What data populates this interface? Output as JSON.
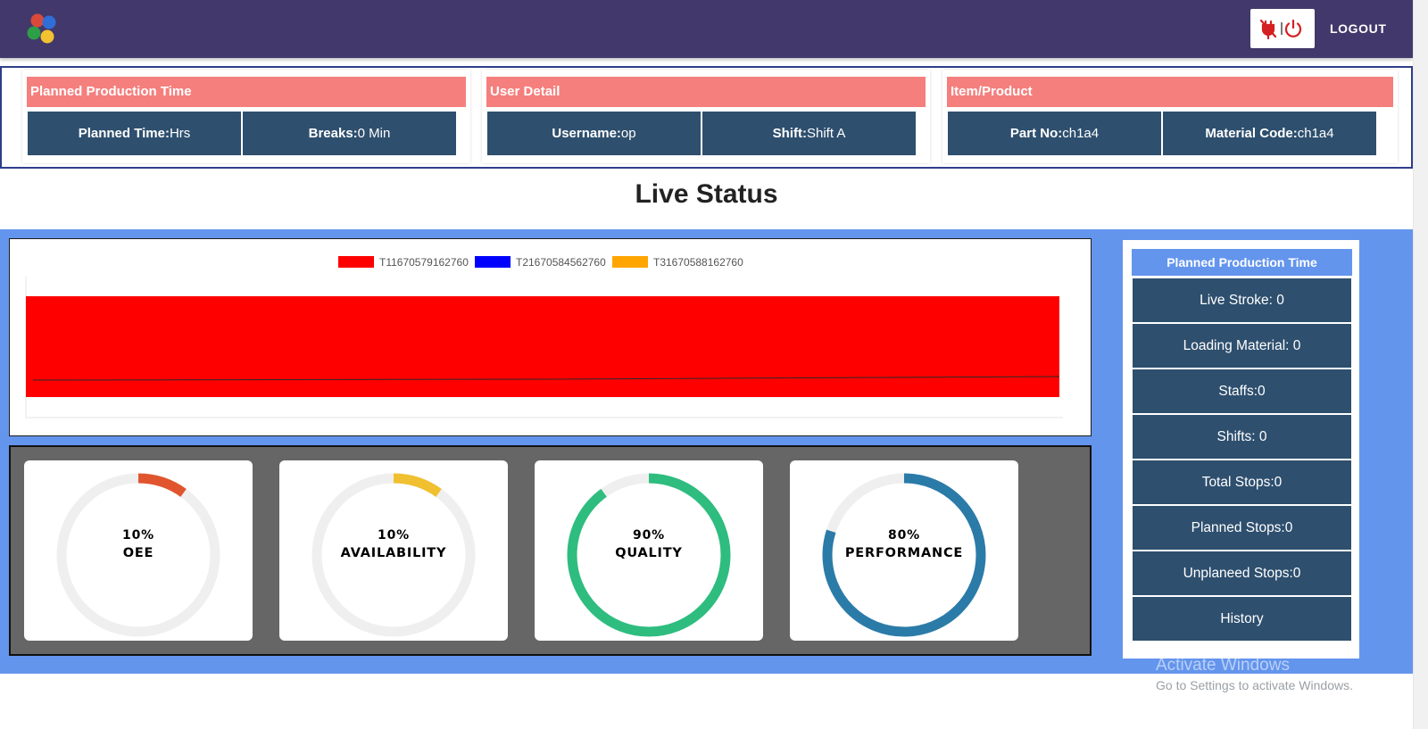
{
  "navbar": {
    "logout_label": "LOGOUT",
    "logo_icon": "colored-dots-logo-icon",
    "connection_icon": "unplugged-power-icon"
  },
  "info": {
    "production": {
      "title": "Planned Production Time",
      "planned_key": "Planned Time:",
      "planned_val": "Hrs",
      "breaks_key": "Breaks:",
      "breaks_val": "0 Min"
    },
    "user": {
      "title": "User Detail",
      "username_key": "Username:",
      "username_val": "op",
      "shift_key": "Shift:",
      "shift_val": "Shift A"
    },
    "item": {
      "title": "Item/Product",
      "part_key": "Part No:",
      "part_val": "ch1a4",
      "material_key": "Material Code:",
      "material_val": "ch1a4"
    }
  },
  "page_title": "Live Status",
  "chart_data": {
    "type": "area",
    "series": [
      {
        "name": "T11670579162760",
        "color": "#ff0000"
      },
      {
        "name": "T21670584562760",
        "color": "#0000ff"
      },
      {
        "name": "T31670588162760",
        "color": "#ffa500"
      }
    ],
    "grid": false,
    "legend": "top-center"
  },
  "gauges": [
    {
      "pct": "10%",
      "label": "OEE",
      "value": 0.1,
      "color": "#e0552e"
    },
    {
      "pct": "10%",
      "label": "AVAILABILITY",
      "value": 0.1,
      "color": "#f0c030"
    },
    {
      "pct": "90%",
      "label": "QUALITY",
      "value": 0.9,
      "color": "#2ebd7f"
    },
    {
      "pct": "80%",
      "label": "PERFORMANCE",
      "value": 0.8,
      "color": "#2b7ba8"
    }
  ],
  "stats": {
    "title": "Planned Production Time",
    "items": [
      "Live Stroke: 0",
      "Loading Material: 0",
      "Staffs:0",
      "Shifts: 0",
      "Total Stops:0",
      "Planned Stops:0",
      "Unplaneed Stops:0",
      "History"
    ]
  },
  "watermark": {
    "line1": "Activate Windows",
    "line2": "Go to Settings to activate Windows."
  },
  "colors": {
    "navbar": "#43386b",
    "accent": "#6495ed",
    "cell": "#2e4f6e",
    "header": "#f57f7d"
  }
}
